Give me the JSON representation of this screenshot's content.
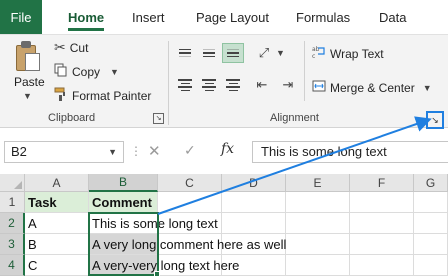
{
  "ribbon_tabs": {
    "file": "File",
    "home": "Home",
    "insert": "Insert",
    "page_layout": "Page Layout",
    "formulas": "Formulas",
    "data": "Data"
  },
  "clipboard": {
    "paste": "Paste",
    "cut": "Cut",
    "copy": "Copy",
    "format_painter": "Format Painter",
    "group_label": "Clipboard"
  },
  "alignment": {
    "wrap_text": "Wrap Text",
    "merge_center": "Merge & Center",
    "group_label": "Alignment"
  },
  "icons": {
    "dialog_launcher": "dialog-launcher-icon",
    "cut": "scissors-icon",
    "copy": "copy-icon",
    "format_painter": "paintbrush-icon",
    "wrap": "wrap-text-icon",
    "merge": "merge-center-icon",
    "orientation": "orientation-icon"
  },
  "formula_bar": {
    "name_box": "B2",
    "cancel": "✕",
    "enter": "✓",
    "fx": "fx",
    "content": "This is some long text"
  },
  "sheet": {
    "columns": [
      "A",
      "B",
      "C",
      "D",
      "E",
      "F",
      "G"
    ],
    "rows": [
      "1",
      "2",
      "3",
      "4"
    ],
    "headers": {
      "a1": "Task",
      "b1": "Comment"
    },
    "data": [
      {
        "a": "A",
        "b": "This is some long text"
      },
      {
        "a": "B",
        "b": "A very long comment here as well"
      },
      {
        "a": "C",
        "b": "A very-very long text here"
      }
    ]
  },
  "colors": {
    "excel_green": "#217346",
    "annotation_blue": "#1f7fe0",
    "header_fill": "#dbeed8"
  }
}
